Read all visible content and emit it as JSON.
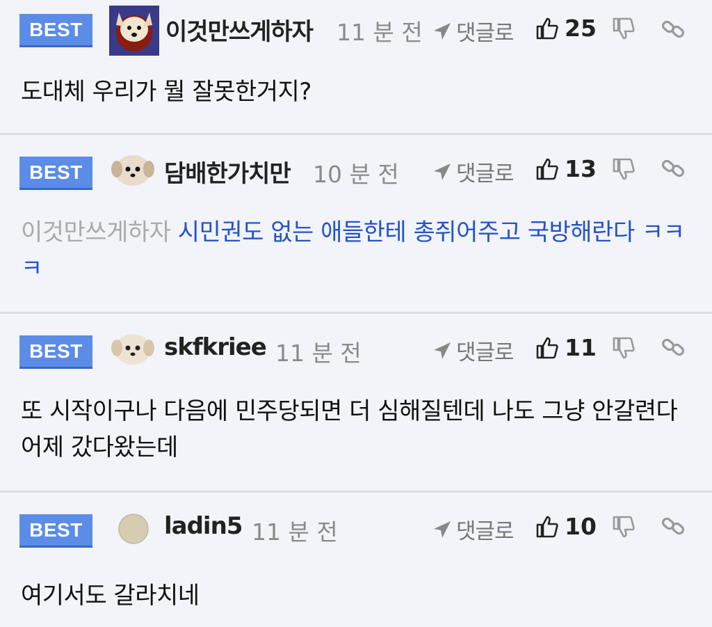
{
  "comments": [
    {
      "badge": "BEST",
      "username": "이것만쓰게하자",
      "time": "11 분 전",
      "reply_label": "댓글로",
      "likes": "25",
      "text": "도대체 우리가 뭘 잘못한거지?"
    },
    {
      "badge": "BEST",
      "username": "담배한가치만",
      "time": "10 분 전",
      "reply_label": "댓글로",
      "likes": "13",
      "mention": "이것만쓰게하자",
      "text": "시민권도 없는 애들한테 총쥐어주고 국방해란다 ㅋㅋㅋ"
    },
    {
      "badge": "BEST",
      "username": "skfkriee",
      "time": "11 분 전",
      "reply_label": "댓글로",
      "likes": "11",
      "text": "또 시작이구나 다음에 민주당되면 더 심해질텐데 나도 그냥 안갈련다 어제 갔다왔는데"
    },
    {
      "badge": "BEST",
      "username": "ladin5",
      "time": "11 분 전",
      "reply_label": "댓글로",
      "likes": "10",
      "text": "여기서도 갈라치네"
    }
  ],
  "colors": {
    "badge": "#5b8ce6",
    "reply_link": "#2453c6",
    "background": "#f2f4fa"
  }
}
